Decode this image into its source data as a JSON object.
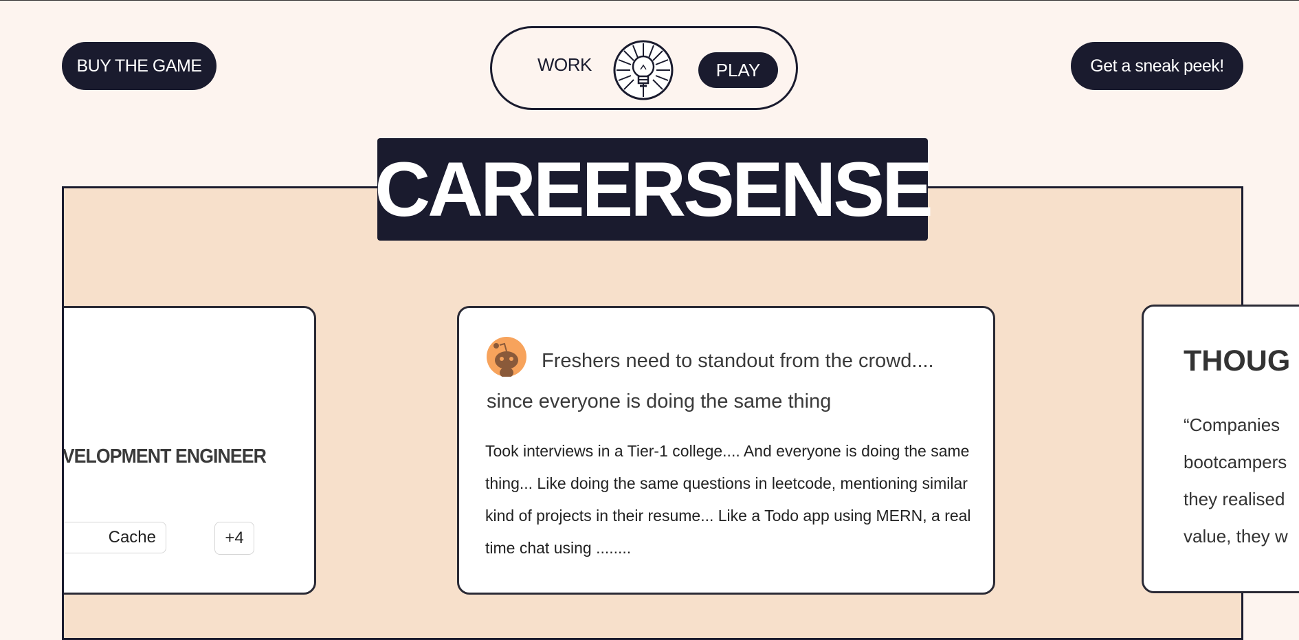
{
  "header": {
    "buy_label": "BUY THE GAME",
    "sneak_peek_label": "Get a sneak peek!",
    "toggle": {
      "work_label": "WORK",
      "play_label": "PLAY",
      "icon": "lightbulb-icon"
    }
  },
  "brand": {
    "title": "CAREERSENSE"
  },
  "cards": {
    "left": {
      "job_title": "VELOPMENT ENGINEER",
      "tags": [
        "Cache",
        "+4"
      ]
    },
    "middle": {
      "avatar_icon": "reddit-icon",
      "title": "Freshers need to standout from the crowd.... since everyone is doing the same thing",
      "body": "Took interviews in a Tier-1 college.... And everyone is doing the same thing... Like doing the same questions in leetcode, mentioning similar kind of projects in their resume... Like a Todo app using MERN, a real time chat using ........"
    },
    "right": {
      "heading": "THOUG",
      "quote_lines": [
        "“Companies",
        "bootcampers",
        "they realised",
        "value, they w"
      ]
    }
  },
  "colors": {
    "navy": "#1a1b2e",
    "page_bg": "#fdf4ef",
    "stage_bg": "#f7e0cb",
    "reddit_orange": "#f7a35c"
  }
}
